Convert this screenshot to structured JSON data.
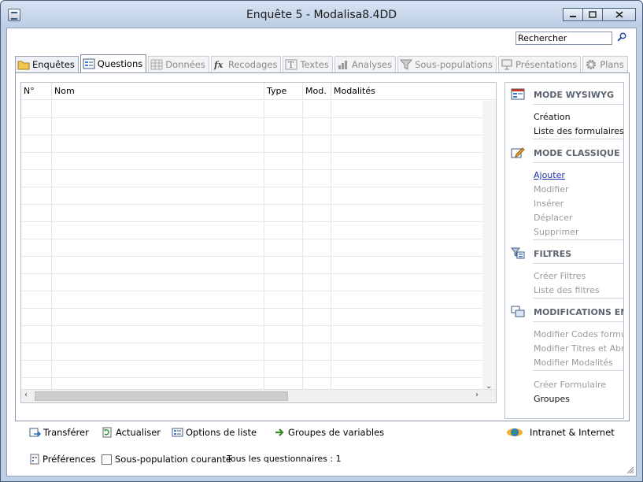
{
  "window": {
    "title": "Enquête 5 - Modalisa8.4DD"
  },
  "search": {
    "value": "Rechercher"
  },
  "tabs": [
    {
      "label": "Enquêtes",
      "icon": "folder-icon",
      "state": "enabled"
    },
    {
      "label": "Questions",
      "icon": "form-icon",
      "state": "active"
    },
    {
      "label": "Données",
      "icon": "table-icon",
      "state": "disabled"
    },
    {
      "label": "Recodages",
      "icon": "fx-icon",
      "state": "disabled"
    },
    {
      "label": "Textes",
      "icon": "text-icon",
      "state": "disabled"
    },
    {
      "label": "Analyses",
      "icon": "bar-chart-icon",
      "state": "disabled"
    },
    {
      "label": "Sous-populations",
      "icon": "filter-icon",
      "state": "disabled"
    },
    {
      "label": "Présentations",
      "icon": "presentation-icon",
      "state": "disabled"
    },
    {
      "label": "Plans",
      "icon": "gear-icon",
      "state": "disabled"
    }
  ],
  "grid": {
    "columns": [
      {
        "label": "N°"
      },
      {
        "label": "Nom"
      },
      {
        "label": "Type"
      },
      {
        "label": "Mod."
      },
      {
        "label": "Modalités"
      }
    ]
  },
  "sidebar": {
    "wysiwyg": {
      "title": "MODE WYSIWYG",
      "items": [
        {
          "label": "Création",
          "state": "on"
        },
        {
          "label": "Liste des formulaires",
          "state": "on"
        }
      ]
    },
    "classique": {
      "title": "MODE CLASSIQUE",
      "items": [
        {
          "label": "Ajouter",
          "state": "link"
        },
        {
          "label": "Modifier",
          "state": "off"
        },
        {
          "label": "Insérer",
          "state": "off"
        },
        {
          "label": "Déplacer",
          "state": "off"
        },
        {
          "label": "Supprimer",
          "state": "off"
        }
      ]
    },
    "filtres": {
      "title": "FILTRES",
      "items": [
        {
          "label": "Créer Filtres",
          "state": "off"
        },
        {
          "label": "Liste des filtres",
          "state": "off"
        }
      ]
    },
    "modifications": {
      "title": "MODIFICATIONS EN SÉRIE",
      "items": [
        {
          "label": "Modifier Codes formulaire",
          "state": "off"
        },
        {
          "label": "Modifier Titres et Abrégés",
          "state": "off"
        },
        {
          "label": "Modifier Modalités",
          "state": "off"
        }
      ]
    },
    "formulaire": {
      "items": [
        {
          "label": "Créer Formulaire",
          "state": "off"
        },
        {
          "label": "Groupes",
          "state": "on"
        }
      ]
    }
  },
  "toolbar": {
    "transferer": "Transférer",
    "actualiser": "Actualiser",
    "options": "Options de liste",
    "groupes": "Groupes de variables",
    "intranet": "Intranet & Internet"
  },
  "footer": {
    "preferences": "Préférences",
    "subpop_label": "Sous-population courante",
    "status": "Tous les questionnaires : 1"
  }
}
